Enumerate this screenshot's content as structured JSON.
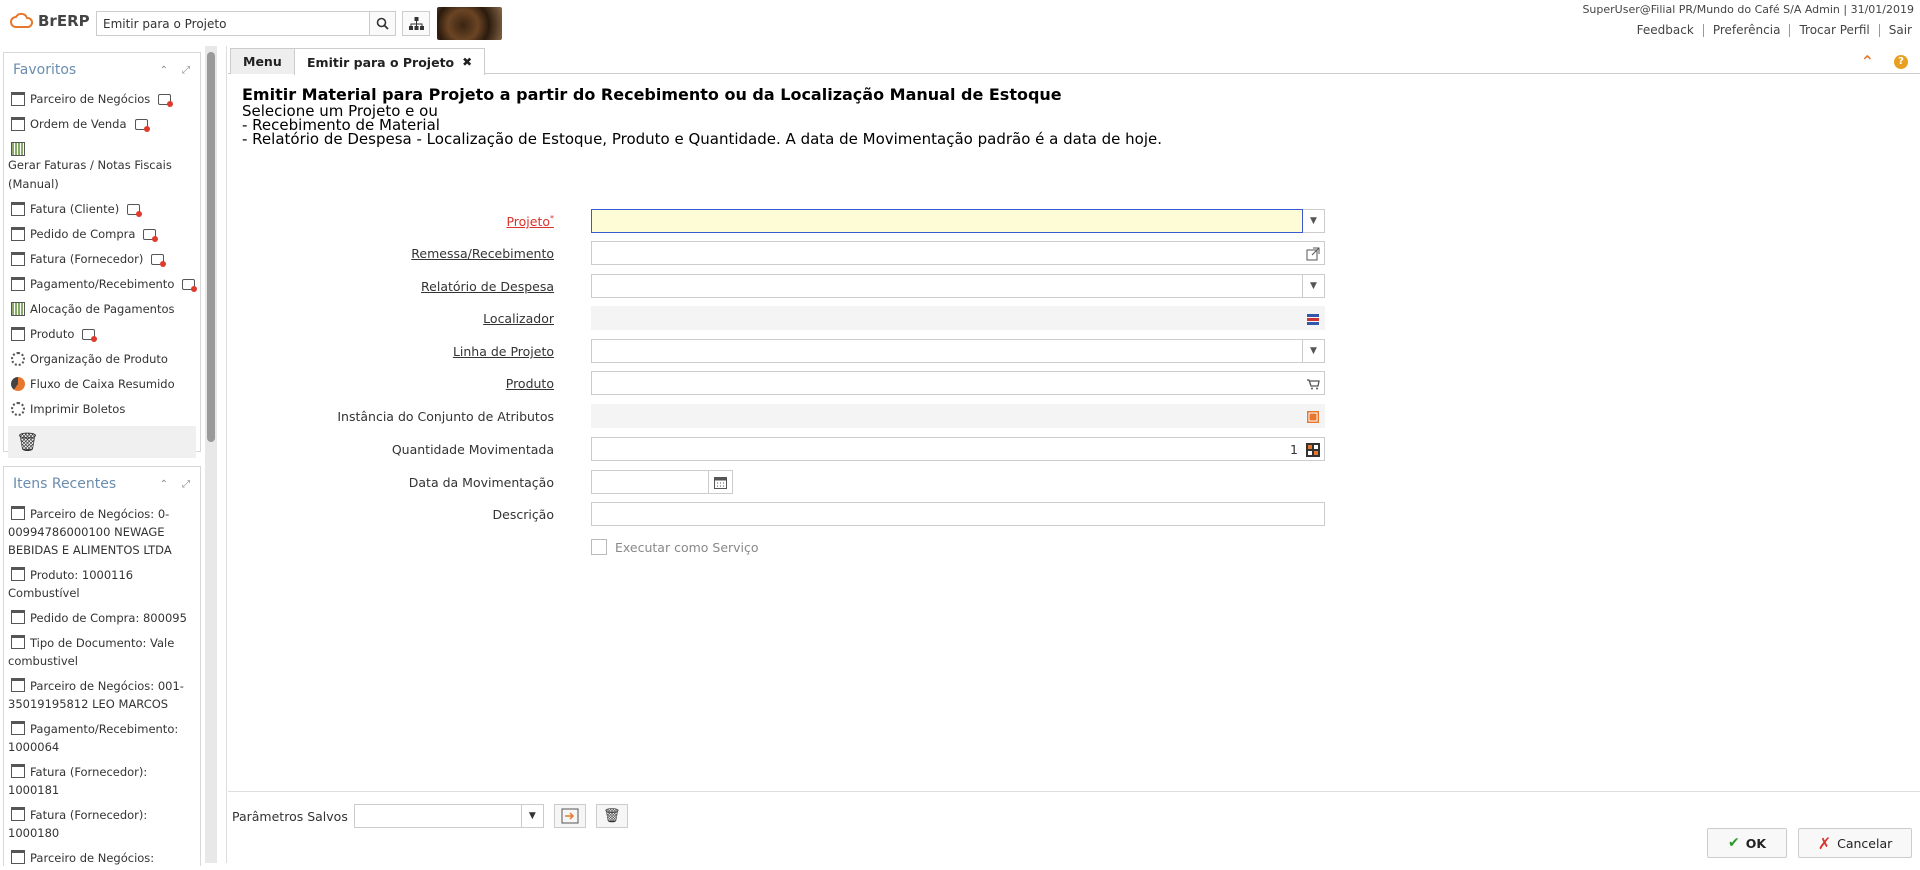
{
  "header": {
    "logo_text": "BrERP",
    "search_value": "Emitir para o Projeto",
    "user_info": "SuperUser@Filial PR/Mundo do Café S/A Admin | 31/01/2019",
    "links": [
      "Feedback",
      "Preferência",
      "Trocar Perfil",
      "Sair"
    ]
  },
  "favorites": {
    "title": "Favoritos",
    "items": [
      {
        "label": "Parceiro de Negócios",
        "icon": "window-icon",
        "badge": true
      },
      {
        "label": "Ordem de Venda",
        "icon": "window-icon",
        "badge": true
      },
      {
        "label": "Gerar Faturas / Notas Fiscais (Manual)",
        "icon": "grid-icon",
        "badge": false
      },
      {
        "label": "Fatura (Cliente)",
        "icon": "window-icon",
        "badge": true
      },
      {
        "label": "Pedido de Compra",
        "icon": "window-icon",
        "badge": true
      },
      {
        "label": "Fatura (Fornecedor)",
        "icon": "window-icon",
        "badge": true
      },
      {
        "label": "Pagamento/Recebimento",
        "icon": "window-icon",
        "badge": true
      },
      {
        "label": "Alocação de Pagamentos",
        "icon": "grid-icon",
        "badge": false
      },
      {
        "label": "Produto",
        "icon": "window-icon",
        "badge": true
      },
      {
        "label": "Organização de Produto",
        "icon": "gear-icon",
        "badge": false
      },
      {
        "label": "Fluxo de Caixa Resumido",
        "icon": "pie-icon",
        "badge": false
      },
      {
        "label": "Imprimir Boletos",
        "icon": "gear-icon",
        "badge": false
      }
    ]
  },
  "recent": {
    "title": "Itens Recentes",
    "items": [
      "Parceiro de Negócios: 0-00994786000100 NEWAGE BEBIDAS E ALIMENTOS LTDA",
      "Produto: 1000116 Combustível",
      "Pedido de Compra: 800095",
      "Tipo de Documento: Vale combustivel",
      "Parceiro de Negócios: 001-35019195812 LEO MARCOS",
      "Pagamento/Recebimento: 1000064",
      "Fatura (Fornecedor): 1000181",
      "Fatura (Fornecedor): 1000180",
      "Parceiro de Negócios:"
    ]
  },
  "tabs": {
    "menu": "Menu",
    "active": "Emitir para o Projeto"
  },
  "process": {
    "heading": "Emitir Material para Projeto a partir do Recebimento ou da Localização Manual de Estoque",
    "lines": [
      "Selecione um Projeto e ou",
      "- Recebimento de Material",
      "- Relatório de Despesa - Localização de Estoque, Produto e Quantidade. A data de Movimentação padrão é a data de hoje."
    ]
  },
  "form": {
    "projeto": "Projeto",
    "remessa": "Remessa/Recebimento",
    "relatorio": "Relatório de Despesa",
    "localizador": "Localizador",
    "linha": "Linha de Projeto",
    "produto": "Produto",
    "instancia": "Instância do Conjunto de Atributos",
    "quantidade": "Quantidade Movimentada",
    "quantidade_value": "1",
    "data": "Data da Movimentação",
    "descricao": "Descrição",
    "servico": "Executar como Serviço"
  },
  "footer": {
    "saved_label": "Parâmetros Salvos",
    "ok": "OK",
    "cancel": "Cancelar"
  },
  "colors": {
    "accent": "#e8772e",
    "required": "#d9342b",
    "focus_bg": "#fefcd6"
  }
}
